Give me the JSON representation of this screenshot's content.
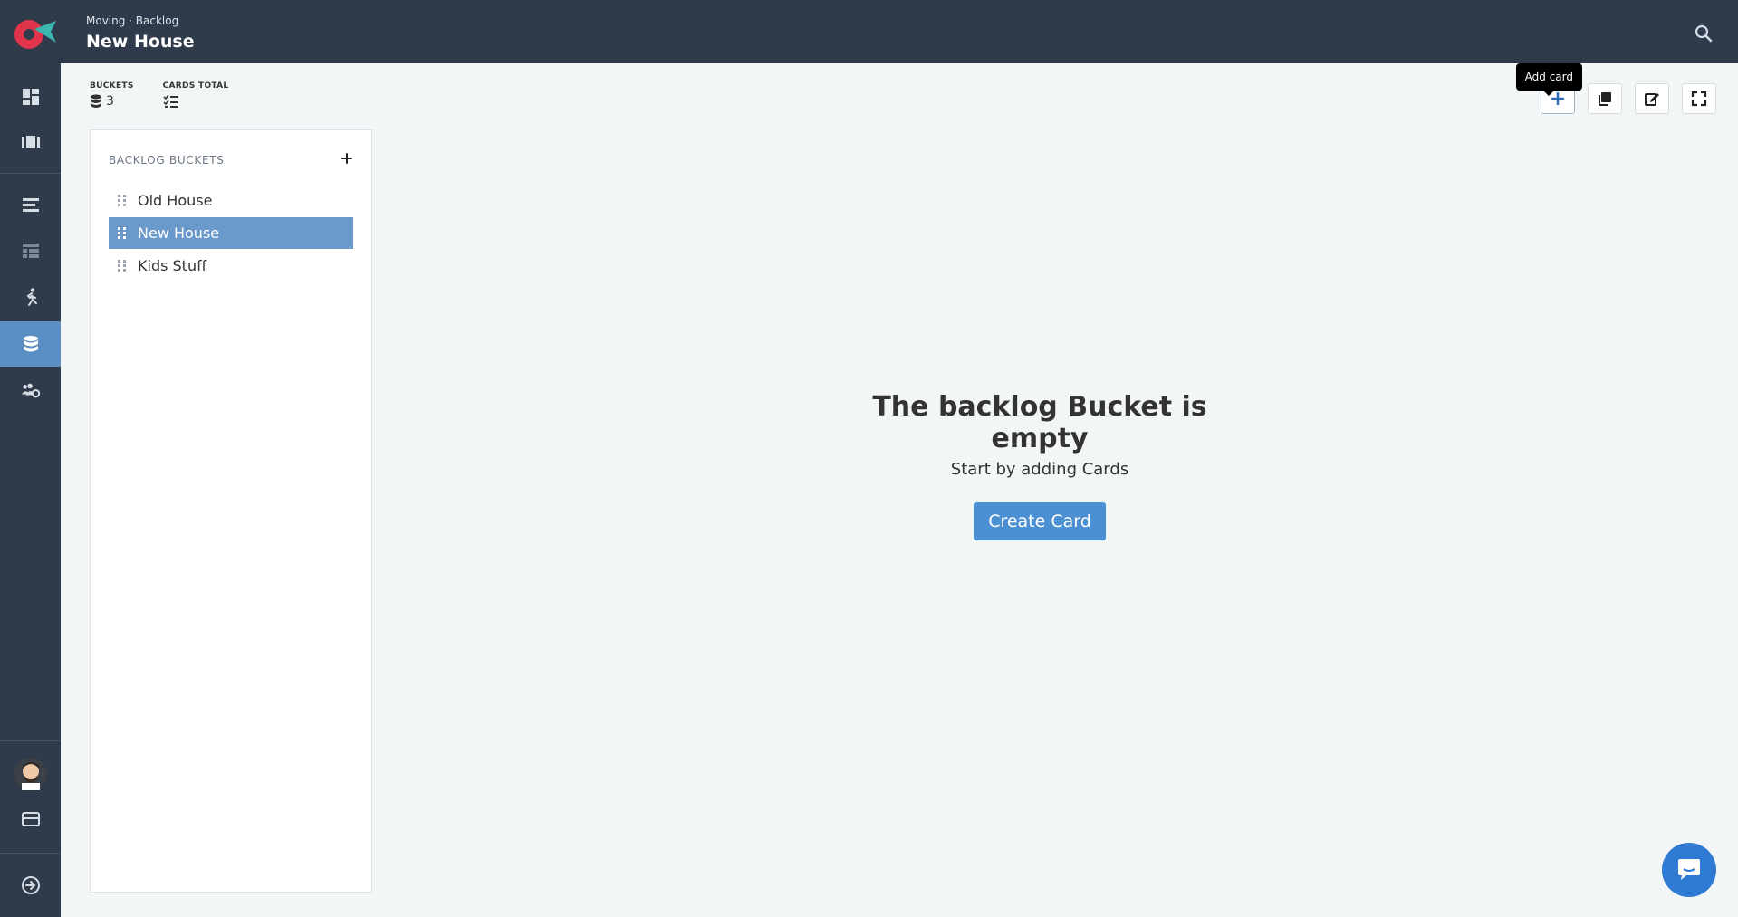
{
  "header": {
    "breadcrumb": "Moving · Backlog",
    "title": "New House",
    "search_icon": "search-icon"
  },
  "sidebar": {
    "items": [
      {
        "name": "dashboard",
        "icon": "dashboard-icon"
      },
      {
        "name": "boards",
        "icon": "kanban-icon"
      },
      {
        "name": "timeline",
        "icon": "list-align-icon"
      },
      {
        "name": "table",
        "icon": "table-icon"
      },
      {
        "name": "sprints",
        "icon": "runner-icon"
      },
      {
        "name": "backlog",
        "icon": "database-icon",
        "active": true
      },
      {
        "name": "team",
        "icon": "users-cog-icon"
      },
      {
        "name": "profile",
        "icon": "avatar"
      },
      {
        "name": "billing",
        "icon": "credit-card-icon"
      },
      {
        "name": "logout",
        "icon": "arrow-circle-right-icon"
      }
    ]
  },
  "stats": {
    "buckets_label": "BUCKETS",
    "buckets_value": "3",
    "cards_label": "CARDS TOTAL"
  },
  "toolbar": {
    "tooltip": "Add card",
    "buttons": [
      "add-card-button",
      "duplicate-button",
      "edit-button",
      "fullscreen-button"
    ]
  },
  "buckets_panel": {
    "title": "BACKLOG BUCKETS",
    "items": [
      {
        "label": "Old House",
        "active": false
      },
      {
        "label": "New House",
        "active": true
      },
      {
        "label": "Kids Stuff",
        "active": false
      }
    ]
  },
  "empty_state": {
    "title": "The backlog Bucket is empty",
    "subtitle": "Start by adding Cards",
    "button": "Create Card"
  },
  "colors": {
    "sidebar": "#2f3a4a",
    "active": "#5b8ec2",
    "primary": "#4a90d2",
    "background": "#f3f6f7"
  }
}
